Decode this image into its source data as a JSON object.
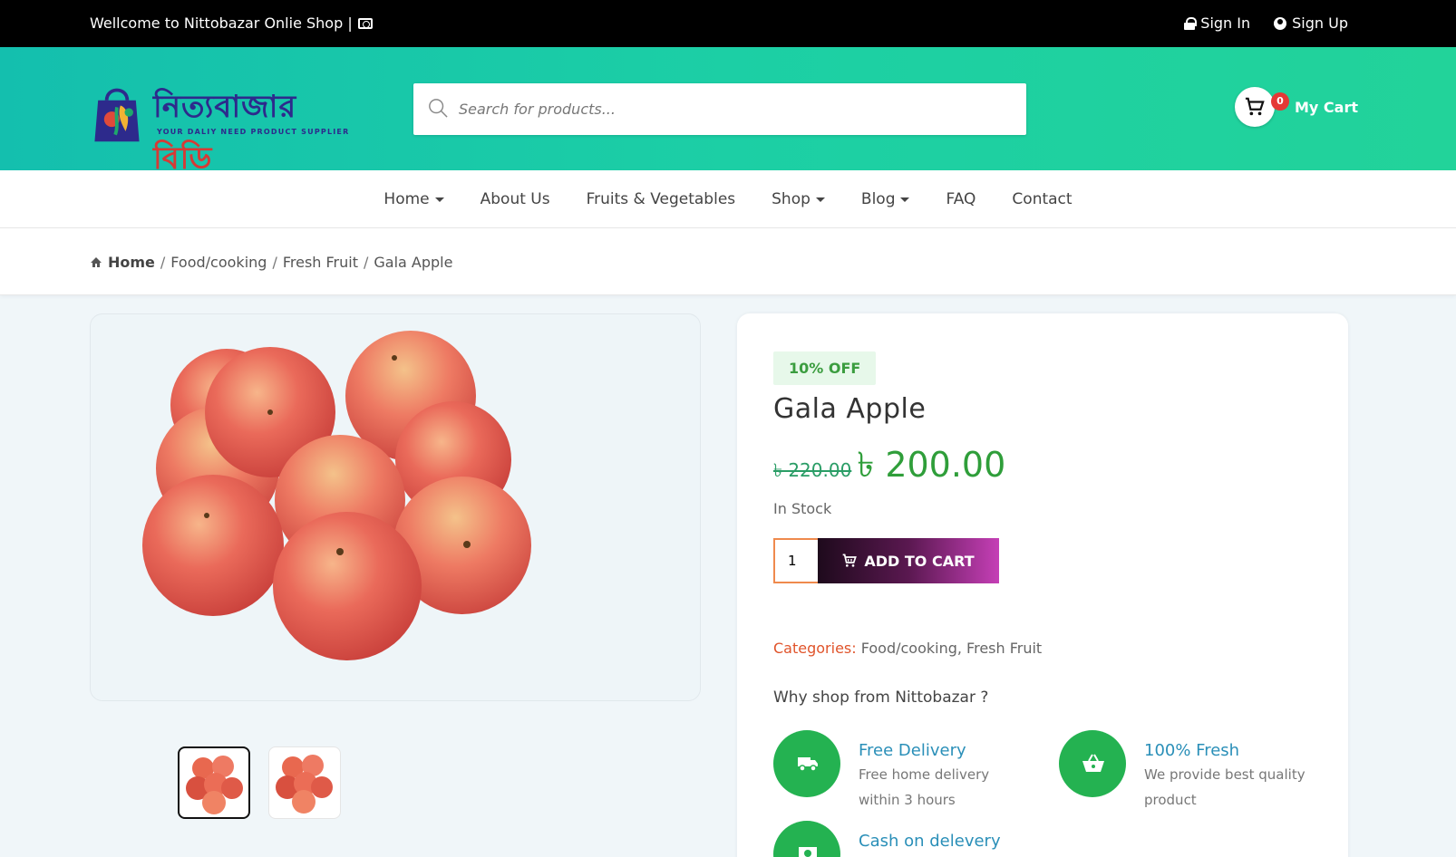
{
  "topbar": {
    "welcome": "Wellcome to Nittobazar Onlie Shop |",
    "sign_in": "Sign In",
    "sign_up": "Sign Up"
  },
  "header": {
    "logo_bn_main": "নিত্যবাজার",
    "logo_bn_accent": "বিডি",
    "logo_tagline": "YOUR DALIY NEED PRODUCT SUPPLIER",
    "search_placeholder": "Search for products...",
    "cart_count": "0",
    "cart_label": "My Cart"
  },
  "nav": {
    "items": [
      {
        "label": "Home",
        "dropdown": true
      },
      {
        "label": "About Us",
        "dropdown": false
      },
      {
        "label": "Fruits & Vegetables",
        "dropdown": false
      },
      {
        "label": "Shop",
        "dropdown": true
      },
      {
        "label": "Blog",
        "dropdown": true
      },
      {
        "label": "FAQ",
        "dropdown": false
      },
      {
        "label": "Contact",
        "dropdown": false
      }
    ]
  },
  "breadcrumb": {
    "home": "Home",
    "items": [
      "Food/cooking",
      "Fresh Fruit",
      "Gala Apple"
    ]
  },
  "product": {
    "discount": "10% OFF",
    "name": "Gala Apple",
    "old_price": "৳ 220.00",
    "new_price": "৳ 200.00",
    "stock": "In Stock",
    "quantity": "1",
    "add_to_cart": "ADD TO CART",
    "categories_label": "Categories:",
    "categories": "Food/cooking, Fresh Fruit"
  },
  "why": {
    "title": "Why shop from Nittobazar ?",
    "features": [
      {
        "title": "Free Delivery",
        "desc": "Free home delivery within 3 hours",
        "icon": "truck-icon"
      },
      {
        "title": "100% Fresh",
        "desc": "We provide best quality product",
        "icon": "basket-icon"
      },
      {
        "title": "Cash on delevery",
        "desc": "",
        "icon": "money-icon"
      }
    ]
  },
  "colors": {
    "accent_green": "#2f9e3a",
    "header_teal": "#1ccfa5",
    "discount_red": "#e53935",
    "category_orange": "#e0542b",
    "feature_blue": "#2a8fb8"
  }
}
